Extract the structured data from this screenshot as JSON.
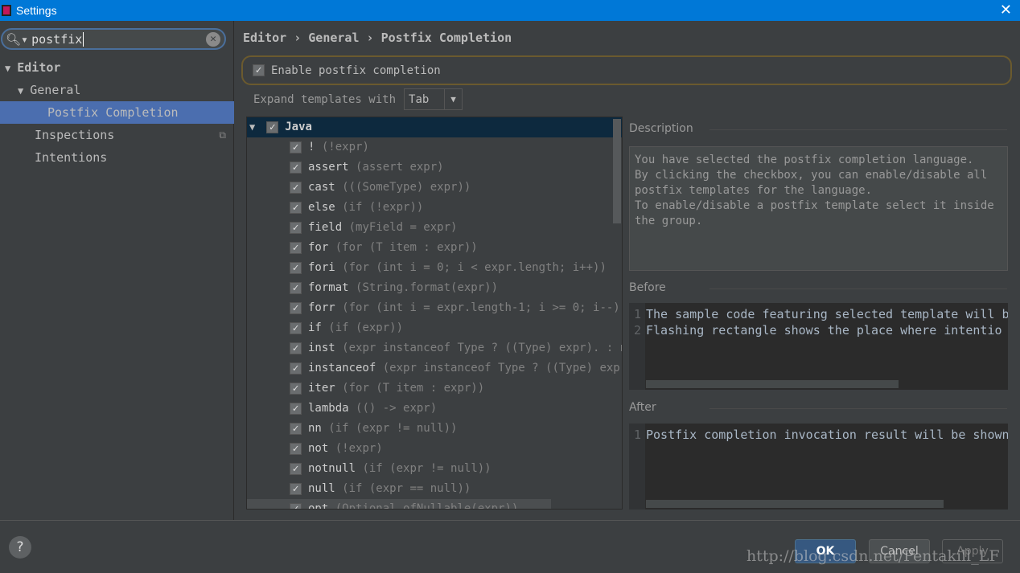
{
  "window": {
    "title": "Settings",
    "close_icon": "close-icon"
  },
  "search": {
    "value": "postfix"
  },
  "tree": [
    {
      "label": "Editor",
      "arrow": "▼"
    },
    {
      "label": "General",
      "arrow": "▼"
    },
    {
      "label": "Postfix Completion",
      "selected": true
    },
    {
      "label": "Inspections"
    },
    {
      "label": "Intentions"
    }
  ],
  "breadcrumb": "Editor › General › Postfix Completion",
  "enable_label": "Enable postfix completion",
  "expand": {
    "label": "Expand templates with",
    "value": "Tab"
  },
  "templates": {
    "group": "Java",
    "items": [
      {
        "k": "!",
        "d": "(!expr)"
      },
      {
        "k": "assert",
        "d": "(assert expr)"
      },
      {
        "k": "cast",
        "d": "(((SomeType) expr))"
      },
      {
        "k": "else",
        "d": "(if (!expr))"
      },
      {
        "k": "field",
        "d": "(myField = expr)"
      },
      {
        "k": "for",
        "d": "(for (T item : expr))"
      },
      {
        "k": "fori",
        "d": "(for (int i = 0; i < expr.length; i++))"
      },
      {
        "k": "format",
        "d": "(String.format(expr))"
      },
      {
        "k": "forr",
        "d": "(for (int i = expr.length-1; i >= 0; i--))"
      },
      {
        "k": "if",
        "d": "(if (expr))"
      },
      {
        "k": "inst",
        "d": "(expr instanceof Type ? ((Type) expr). : nul"
      },
      {
        "k": "instanceof",
        "d": "(expr instanceof Type ? ((Type) expr)."
      },
      {
        "k": "iter",
        "d": "(for (T item : expr))"
      },
      {
        "k": "lambda",
        "d": "(() -> expr)"
      },
      {
        "k": "nn",
        "d": "(if (expr != null))"
      },
      {
        "k": "not",
        "d": "(!expr)"
      },
      {
        "k": "notnull",
        "d": "(if (expr != null))"
      },
      {
        "k": "null",
        "d": "(if (expr == null))"
      },
      {
        "k": "opt",
        "d": "(Optional.ofNullable(expr))"
      }
    ]
  },
  "description": {
    "title": "Description",
    "text": "You have selected the postfix completion language.\nBy clicking the checkbox, you can enable/disable all\npostfix templates for the language.\nTo enable/disable a postfix template select it inside\nthe group."
  },
  "before": {
    "title": "Before",
    "lines": [
      "The sample code featuring selected template will b",
      " Flashing rectangle shows the place where intentio"
    ]
  },
  "after": {
    "title": "After",
    "lines": [
      "Postfix completion invocation result will be shown"
    ]
  },
  "buttons": {
    "ok": "OK",
    "cancel": "Cancel",
    "apply": "Apply",
    "help": "?"
  },
  "watermark": "http://blog.csdn.net/Pentakill_LF"
}
